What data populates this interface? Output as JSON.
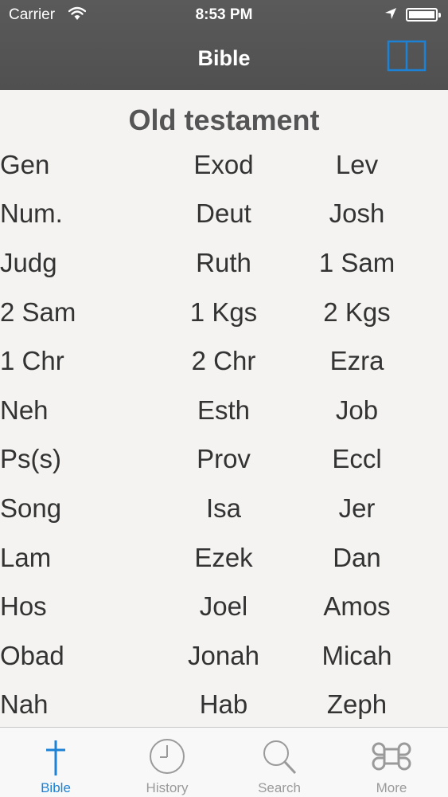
{
  "status_bar": {
    "carrier": "Carrier",
    "time": "8:53 PM"
  },
  "nav": {
    "title": "Bible",
    "book_icon": "open-book-icon"
  },
  "section": {
    "title": "Old testament"
  },
  "books": [
    "Gen",
    "Exod",
    "Lev",
    "Num.",
    "Deut",
    "Josh",
    "Judg",
    "Ruth",
    "1 Sam",
    "2 Sam",
    "1 Kgs",
    "2 Kgs",
    "1 Chr",
    "2 Chr",
    "Ezra",
    "Neh",
    "Esth",
    "Job",
    "Ps(s)",
    "Prov",
    "Eccl",
    "Song",
    "Isa",
    "Jer",
    "Lam",
    "Ezek",
    "Dan",
    "Hos",
    "Joel",
    "Amos",
    "Obad",
    "Jonah",
    "Micah",
    "Nah",
    "Hab",
    "Zeph"
  ],
  "tabs": [
    {
      "label": "Bible",
      "icon": "cross-icon",
      "active": true
    },
    {
      "label": "History",
      "icon": "clock-icon",
      "active": false
    },
    {
      "label": "Search",
      "icon": "magnifier-icon",
      "active": false
    },
    {
      "label": "More",
      "icon": "command-key-icon",
      "active": false
    }
  ],
  "colors": {
    "accent": "#1c82d6",
    "nav_bg": "#555555",
    "page_bg": "#f4f3f1",
    "tab_inactive": "#9a9a9a"
  }
}
